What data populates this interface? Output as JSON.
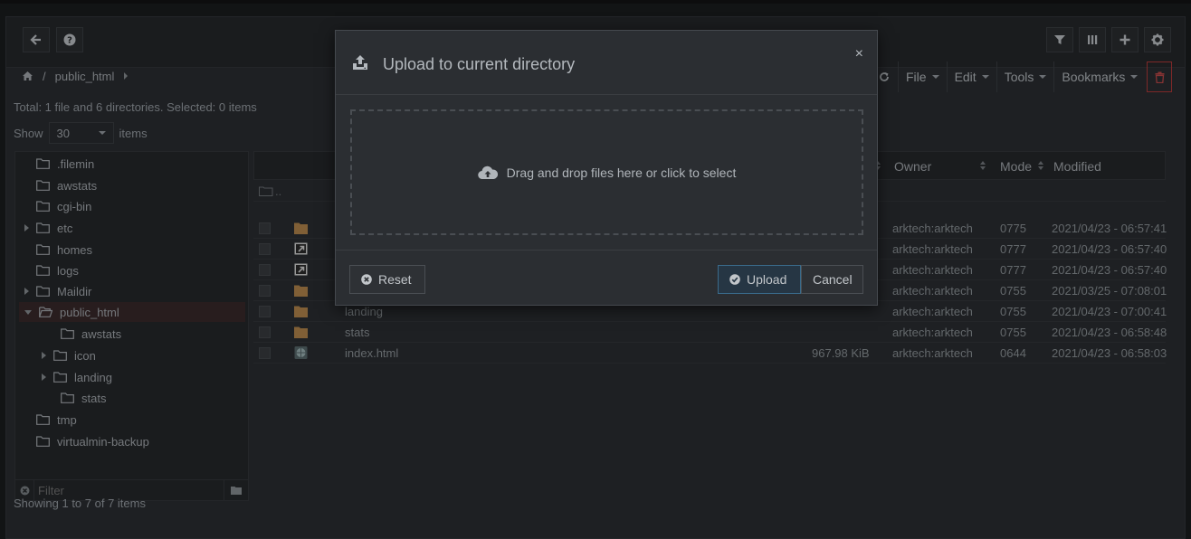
{
  "app": {
    "breadcrumb": {
      "home_icon": "home-icon",
      "separator": "/",
      "current": "public_html"
    },
    "status_text": "Total: 1 file and 6 directories. Selected: 0 items",
    "show": {
      "label": "Show",
      "value": "30",
      "suffix": "items"
    },
    "menus": [
      {
        "label": "File"
      },
      {
        "label": "Edit"
      },
      {
        "label": "Tools"
      },
      {
        "label": "Bookmarks"
      }
    ],
    "tree": {
      "items": [
        {
          "label": ".filemin",
          "expandable": false
        },
        {
          "label": "awstats",
          "expandable": false
        },
        {
          "label": "cgi-bin",
          "expandable": false
        },
        {
          "label": "etc",
          "expandable": true
        },
        {
          "label": "homes",
          "expandable": false
        },
        {
          "label": "logs",
          "expandable": false
        },
        {
          "label": "Maildir",
          "expandable": true
        },
        {
          "label": "public_html",
          "expandable": true,
          "expanded": true,
          "selected": true
        },
        {
          "label": "awstats",
          "expandable": false,
          "child": true
        },
        {
          "label": "icon",
          "expandable": true,
          "child": true
        },
        {
          "label": "landing",
          "expandable": true,
          "child": true
        },
        {
          "label": "stats",
          "expandable": false,
          "child": true
        },
        {
          "label": "tmp",
          "expandable": false
        },
        {
          "label": "virtualmin-backup",
          "expandable": false
        }
      ],
      "filter_placeholder": "Filter"
    },
    "showing_text": "Showing 1 to 7 of 7 items",
    "table": {
      "columns": {
        "owner": "Owner",
        "mode": "Mode",
        "modified": "Modified"
      },
      "parent_row": "..",
      "rows": [
        {
          "icon": "folder",
          "name": "",
          "size": "",
          "owner": "arktech:arktech",
          "mode": "0775",
          "modified": "2021/04/23 - 06:57:41"
        },
        {
          "icon": "symlink",
          "name": "",
          "size": "",
          "owner": "arktech:arktech",
          "mode": "0777",
          "modified": "2021/04/23 - 06:57:40"
        },
        {
          "icon": "symlink",
          "name": "",
          "size": "",
          "owner": "arktech:arktech",
          "mode": "0777",
          "modified": "2021/04/23 - 06:57:40"
        },
        {
          "icon": "folder",
          "name": "",
          "size": "",
          "owner": "arktech:arktech",
          "mode": "0755",
          "modified": "2021/03/25 - 07:08:01"
        },
        {
          "icon": "folder",
          "name": "landing",
          "size": "",
          "owner": "arktech:arktech",
          "mode": "0755",
          "modified": "2021/04/23 - 07:00:41"
        },
        {
          "icon": "folder",
          "name": "stats",
          "size": "",
          "owner": "arktech:arktech",
          "mode": "0755",
          "modified": "2021/04/23 - 06:58:48"
        },
        {
          "icon": "html",
          "name": "index.html",
          "size": "967.98 KiB",
          "owner": "arktech:arktech",
          "mode": "0644",
          "modified": "2021/04/23 - 06:58:03"
        }
      ]
    }
  },
  "modal": {
    "title": "Upload to current directory",
    "close": "×",
    "dropzone_text": "Drag and drop files here or click to select",
    "reset_label": "Reset",
    "upload_label": "Upload",
    "cancel_label": "Cancel"
  },
  "colors": {
    "folder": "#b8894e",
    "danger": "#b33a3a",
    "primary_border": "#3a6a8a"
  }
}
